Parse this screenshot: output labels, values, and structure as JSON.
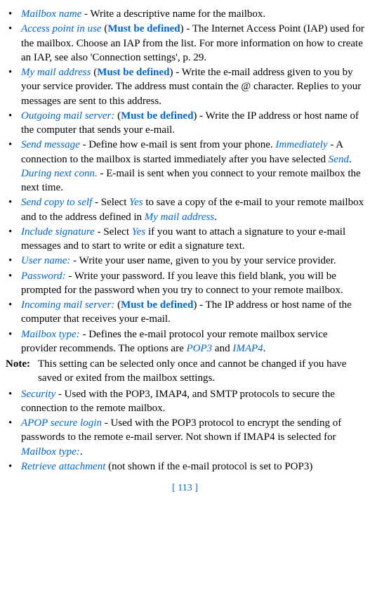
{
  "items": [
    {
      "opt": "Mailbox name",
      "rest_a": " - Write a descriptive name for the mailbox."
    },
    {
      "opt": "Access point in use",
      "must": " (Must be defined)",
      "rest_a": " - The Internet Access Point (IAP) used for the mailbox. Choose an IAP from the list. For more information on how to create an IAP, see also 'Connection settings', p. 29."
    },
    {
      "opt": "My mail address",
      "must": " (Must be defined)",
      "rest_a": " - Write the e-mail address given to you by your service provider. The address must contain the @ character. Replies to your messages are sent to this address."
    },
    {
      "opt": "Outgoing mail server:",
      "must": " (Must be defined)",
      "rest_a": " - Write the IP address or host name of the computer that sends your e-mail."
    },
    {
      "opt": "Send message",
      "rest_a": " - Define how e-mail is sent from your phone. ",
      "opt2": "Immediately",
      "rest_b": " - A connection to the mailbox is started immediately after you have selected ",
      "opt3": "Send",
      "rest_c": ". ",
      "opt4": "During next conn.",
      "rest_d": " - E-mail is sent when you connect to your remote mailbox the next time."
    },
    {
      "opt": "Send copy to self",
      "rest_a": " - Select ",
      "opt2": "Yes",
      "rest_b": " to save a copy of the e-mail to your remote mailbox and to the address defined in ",
      "opt3": "My mail address",
      "rest_c": "."
    },
    {
      "opt": "Include signature",
      "rest_a": " - Select ",
      "opt2": "Yes",
      "rest_b": " if you want to attach a signature to your e-mail messages and to start to write or edit a signature text."
    },
    {
      "opt": "User name:",
      "rest_a": " - Write your user name, given to you by your service provider."
    },
    {
      "opt": "Password:",
      "rest_a": " - Write your password. If you leave this field blank, you will be prompted for the password when you try to connect to your remote mailbox."
    },
    {
      "opt": "Incoming mail server:",
      "must": " (Must be defined)",
      "rest_a": " - The IP address or host name of the computer that receives your e-mail."
    },
    {
      "opt": "Mailbox type:",
      "rest_a": " - Defines the e-mail protocol your remote mailbox service provider recommends. The options are ",
      "opt2": "POP3",
      "rest_b": " and ",
      "opt3": "IMAP4",
      "rest_c": "."
    }
  ],
  "note": {
    "label": "Note:",
    "body": "This setting can be selected only once and cannot be changed if you have saved or exited from the mailbox settings."
  },
  "items2": [
    {
      "opt": "Security",
      "rest_a": " - Used with the POP3, IMAP4, and SMTP protocols to secure the connection to the remote mailbox."
    },
    {
      "opt": "APOP secure login",
      "rest_a": " - Used with the POP3 protocol to encrypt the sending of passwords to the remote e-mail server. Not shown if IMAP4 is selected for ",
      "opt2": "Mailbox type:",
      "rest_b": "."
    },
    {
      "opt": "Retrieve attachment",
      "rest_a": " (not shown if the e-mail protocol is set to POP3)"
    }
  ],
  "page": "[ 113 ]",
  "must_open": "(",
  "must_text": "Must be defined",
  "must_close": ")"
}
